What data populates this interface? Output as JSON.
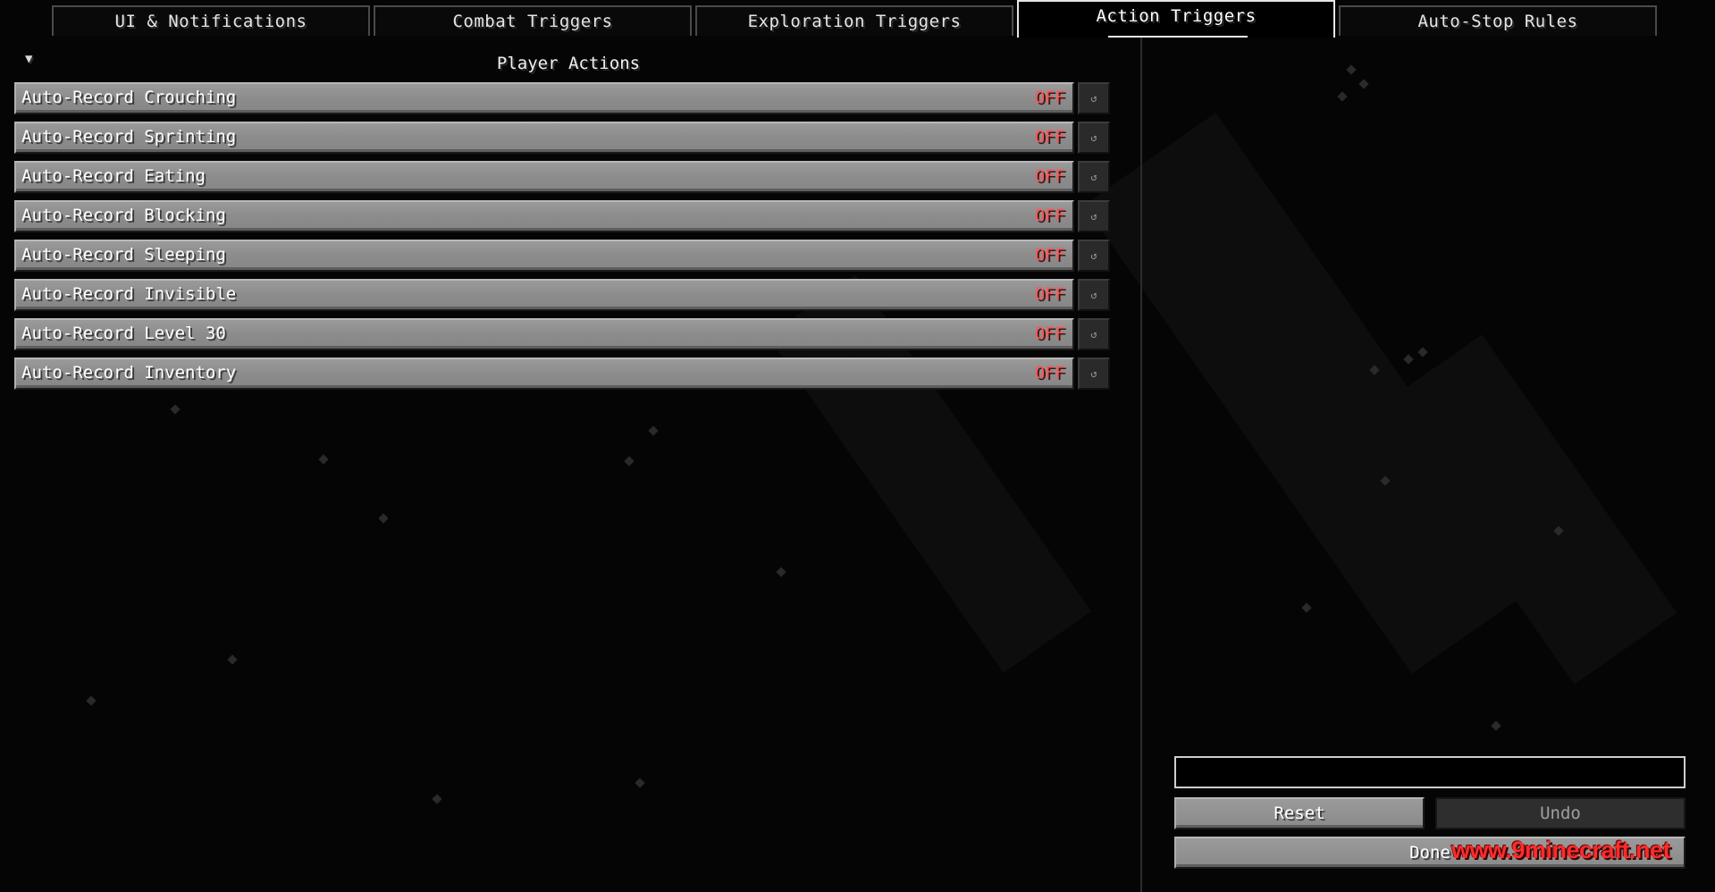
{
  "tabs": [
    {
      "label": "UI & Notifications",
      "active": false
    },
    {
      "label": "Combat Triggers",
      "active": false
    },
    {
      "label": "Exploration Triggers",
      "active": false
    },
    {
      "label": "Action Triggers",
      "active": true
    },
    {
      "label": "Auto-Stop Rules",
      "active": false
    }
  ],
  "section": {
    "title": "Player Actions",
    "collapse_icon": "triangle-down-icon",
    "collapse_glyph": "▼"
  },
  "options": [
    {
      "label": "Auto-Record Crouching",
      "state": "OFF"
    },
    {
      "label": "Auto-Record Sprinting",
      "state": "OFF"
    },
    {
      "label": "Auto-Record Eating",
      "state": "OFF"
    },
    {
      "label": "Auto-Record Blocking",
      "state": "OFF"
    },
    {
      "label": "Auto-Record Sleeping",
      "state": "OFF"
    },
    {
      "label": "Auto-Record Invisible",
      "state": "OFF"
    },
    {
      "label": "Auto-Record Level 30",
      "state": "OFF"
    },
    {
      "label": "Auto-Record Inventory",
      "state": "OFF"
    }
  ],
  "row_reset_icon": "reset-icon",
  "row_reset_glyph": "↺",
  "search": {
    "value": "",
    "placeholder": ""
  },
  "buttons": {
    "reset": "Reset",
    "undo": "Undo",
    "done": "Done"
  },
  "watermark": "www.9minecraft.net",
  "colors": {
    "off_state": "#ff5555",
    "button_gray": "#8c8c8c",
    "background": "#050505",
    "watermark": "#ff2b2b"
  }
}
